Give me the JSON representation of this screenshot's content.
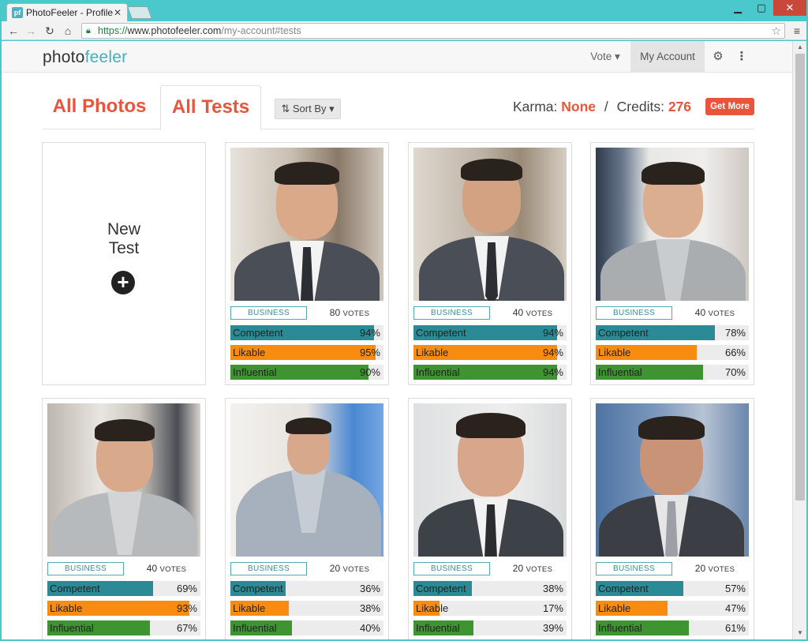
{
  "browser": {
    "tab_title": "PhotoFeeler - Profile",
    "favicon_text": "pf",
    "url_scheme": "https://",
    "url_host": "www.photofeeler.com",
    "url_path": "/my-account#tests"
  },
  "header": {
    "logo_a": "photo",
    "logo_b": "feeler",
    "vote_label": "Vote ▾",
    "account_label": "My Account"
  },
  "toolbar": {
    "tab_photos": "All Photos",
    "tab_tests": "All Tests",
    "sort_label": "Sort By ▾",
    "karma_label": "Karma:",
    "karma_value": "None",
    "separator": "/",
    "credits_label": "Credits:",
    "credits_value": "276",
    "get_more_label": "Get More"
  },
  "new_test": {
    "line1": "New",
    "line2": "Test"
  },
  "metric_labels": [
    "Competent",
    "Likable",
    "Influential"
  ],
  "colors": {
    "competent": "#2a8a96",
    "likable": "#f78c10",
    "influential": "#3d9430",
    "accent": "#e9553c",
    "teal": "#47aebb"
  },
  "tests": [
    {
      "category": "BUSINESS",
      "votes": "80",
      "vote_word": "VOTES",
      "competent": 94,
      "likable": 95,
      "influential": 90,
      "competent_text": "94%",
      "likable_text": "95%",
      "influential_text": "90%"
    },
    {
      "category": "BUSINESS",
      "votes": "40",
      "vote_word": "VOTES",
      "competent": 94,
      "likable": 94,
      "influential": 94,
      "competent_text": "94%",
      "likable_text": "94%",
      "influential_text": "94%"
    },
    {
      "category": "BUSINESS",
      "votes": "40",
      "vote_word": "VOTES",
      "competent": 78,
      "likable": 66,
      "influential": 70,
      "competent_text": "78%",
      "likable_text": "66%",
      "influential_text": "70%"
    },
    {
      "category": "BUSINESS",
      "votes": "40",
      "vote_word": "VOTES",
      "competent": 69,
      "likable": 93,
      "influential": 67,
      "competent_text": "69%",
      "likable_text": "93%",
      "influential_text": "67%"
    },
    {
      "category": "BUSINESS",
      "votes": "20",
      "vote_word": "VOTES",
      "competent": 36,
      "likable": 38,
      "influential": 40,
      "competent_text": "36%",
      "likable_text": "38%",
      "influential_text": "40%"
    },
    {
      "category": "BUSINESS",
      "votes": "20",
      "vote_word": "VOTES",
      "competent": 38,
      "likable": 17,
      "influential": 39,
      "competent_text": "38%",
      "likable_text": "17%",
      "influential_text": "39%"
    },
    {
      "category": "BUSINESS",
      "votes": "20",
      "vote_word": "VOTES",
      "competent": 57,
      "likable": 47,
      "influential": 61,
      "competent_text": "57%",
      "likable_text": "47%",
      "influential_text": "61%"
    }
  ]
}
